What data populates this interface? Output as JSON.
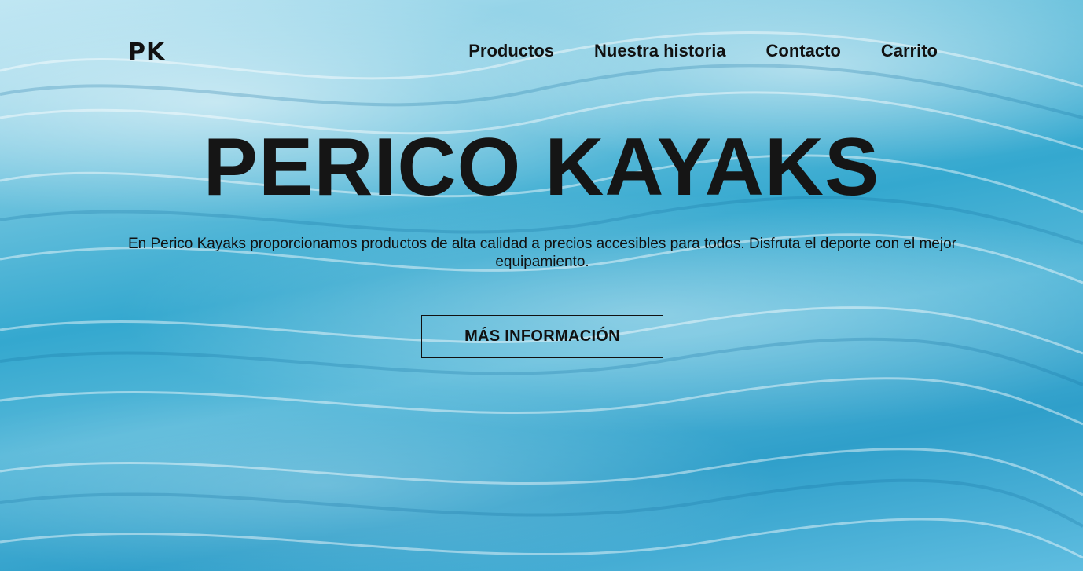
{
  "nav": {
    "logo": "PK",
    "links": [
      "Productos",
      "Nuestra historia",
      "Contacto",
      "Carrito"
    ]
  },
  "hero": {
    "title": "PERICO KAYAKS",
    "description": "En Perico Kayaks proporcionamos productos de alta calidad a precios accesibles para todos. Disfruta el deporte con el mejor equipamiento.",
    "button_label": "MÁS INFORMACIÓN"
  },
  "colors": {
    "text": "#111111",
    "water_light": "#bfe6f3",
    "water_mid": "#34a8cf"
  }
}
